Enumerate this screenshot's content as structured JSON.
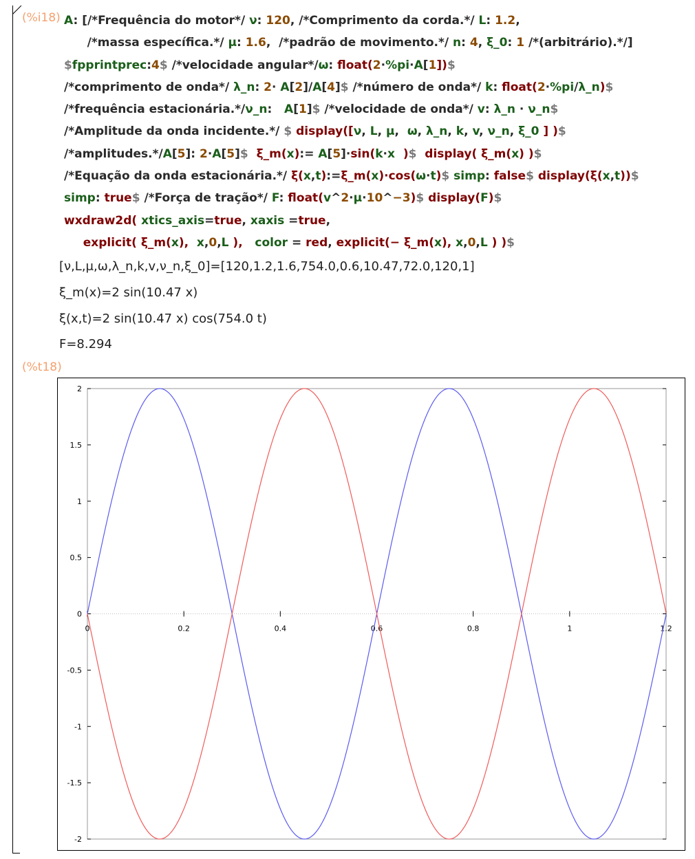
{
  "cells": {
    "input_label": "(%i18)",
    "plot_label": "(%t18)"
  },
  "code_lines": [
    [
      {
        "t": "A",
        "c": "v"
      },
      {
        "t": ": [/*Frequência do motor*/ ",
        "c": "c"
      },
      {
        "t": "ν",
        "c": "v"
      },
      {
        "t": ": ",
        "c": "c"
      },
      {
        "t": "120",
        "c": "n"
      },
      {
        "t": ", /*Comprimento da corda.*/ ",
        "c": "c"
      },
      {
        "t": "L",
        "c": "v"
      },
      {
        "t": ": ",
        "c": "c"
      },
      {
        "t": "1.2",
        "c": "n"
      },
      {
        "t": ",",
        "c": "c"
      }
    ],
    [
      {
        "t": "    /*massa específica.*/ ",
        "c": "c"
      },
      {
        "t": "μ",
        "c": "v"
      },
      {
        "t": ": ",
        "c": "c"
      },
      {
        "t": "1.6",
        "c": "n"
      },
      {
        "t": ",  /*padrão de movimento.*/ ",
        "c": "c"
      },
      {
        "t": "n",
        "c": "v"
      },
      {
        "t": ": ",
        "c": "c"
      },
      {
        "t": "4",
        "c": "n"
      },
      {
        "t": ", ",
        "c": "c"
      },
      {
        "t": "ξ_0",
        "c": "v"
      },
      {
        "t": ": ",
        "c": "c"
      },
      {
        "t": "1",
        "c": "n"
      },
      {
        "t": " /*(arbitrário).*/]",
        "c": "c"
      }
    ],
    [
      {
        "t": "$",
        "c": "o"
      },
      {
        "t": "fpprintprec",
        "c": "v"
      },
      {
        "t": ":",
        "c": "c"
      },
      {
        "t": "4",
        "c": "n"
      },
      {
        "t": "$",
        "c": "o"
      },
      {
        "t": " /*velocidade angular*/",
        "c": "c"
      },
      {
        "t": "ω",
        "c": "v"
      },
      {
        "t": ": ",
        "c": "c"
      },
      {
        "t": "float",
        "c": "k"
      },
      {
        "t": "(",
        "c": "k"
      },
      {
        "t": "2",
        "c": "n"
      },
      {
        "t": "·",
        "c": "c"
      },
      {
        "t": "%pi",
        "c": "v"
      },
      {
        "t": "·",
        "c": "c"
      },
      {
        "t": "A",
        "c": "v"
      },
      {
        "t": "[",
        "c": "c"
      },
      {
        "t": "1",
        "c": "n"
      },
      {
        "t": "])",
        "c": "k"
      },
      {
        "t": "$",
        "c": "o"
      }
    ],
    [
      {
        "t": "/*comprimento de onda*/ ",
        "c": "c"
      },
      {
        "t": "λ_n",
        "c": "v"
      },
      {
        "t": ": ",
        "c": "c"
      },
      {
        "t": "2",
        "c": "n"
      },
      {
        "t": "· ",
        "c": "c"
      },
      {
        "t": "A",
        "c": "v"
      },
      {
        "t": "[",
        "c": "c"
      },
      {
        "t": "2",
        "c": "n"
      },
      {
        "t": "]/",
        "c": "c"
      },
      {
        "t": "A",
        "c": "v"
      },
      {
        "t": "[",
        "c": "c"
      },
      {
        "t": "4",
        "c": "n"
      },
      {
        "t": "]",
        "c": "c"
      },
      {
        "t": "$",
        "c": "o"
      },
      {
        "t": " /*número de onda*/ ",
        "c": "c"
      },
      {
        "t": "k",
        "c": "v"
      },
      {
        "t": ": ",
        "c": "c"
      },
      {
        "t": "float",
        "c": "k"
      },
      {
        "t": "(",
        "c": "k"
      },
      {
        "t": "2",
        "c": "n"
      },
      {
        "t": "·",
        "c": "c"
      },
      {
        "t": "%pi",
        "c": "v"
      },
      {
        "t": "/",
        "c": "c"
      },
      {
        "t": "λ_n",
        "c": "v"
      },
      {
        "t": ")",
        "c": "k"
      },
      {
        "t": "$",
        "c": "o"
      }
    ],
    [
      {
        "t": "/*frequência estacionária.*/",
        "c": "c"
      },
      {
        "t": "ν_n",
        "c": "v"
      },
      {
        "t": ":   ",
        "c": "c"
      },
      {
        "t": "A",
        "c": "v"
      },
      {
        "t": "[",
        "c": "c"
      },
      {
        "t": "1",
        "c": "n"
      },
      {
        "t": "]",
        "c": "c"
      },
      {
        "t": "$",
        "c": "o"
      },
      {
        "t": " /*velocidade de onda*/ ",
        "c": "c"
      },
      {
        "t": "v",
        "c": "v"
      },
      {
        "t": ": ",
        "c": "c"
      },
      {
        "t": "λ_n",
        "c": "v"
      },
      {
        "t": " · ",
        "c": "c"
      },
      {
        "t": "ν_n",
        "c": "v"
      },
      {
        "t": "$",
        "c": "o"
      }
    ],
    [
      {
        "t": "/*Amplitude da onda incidente.*/ ",
        "c": "c"
      },
      {
        "t": "$",
        "c": "o"
      },
      {
        "t": " ",
        "c": "c"
      },
      {
        "t": "display",
        "c": "k"
      },
      {
        "t": "([",
        "c": "k"
      },
      {
        "t": "ν",
        "c": "v"
      },
      {
        "t": ", ",
        "c": "c"
      },
      {
        "t": "L",
        "c": "v"
      },
      {
        "t": ", ",
        "c": "c"
      },
      {
        "t": "μ",
        "c": "v"
      },
      {
        "t": ",  ",
        "c": "c"
      },
      {
        "t": "ω",
        "c": "v"
      },
      {
        "t": ", ",
        "c": "c"
      },
      {
        "t": "λ_n",
        "c": "v"
      },
      {
        "t": ", ",
        "c": "c"
      },
      {
        "t": "k",
        "c": "v"
      },
      {
        "t": ", ",
        "c": "c"
      },
      {
        "t": "v",
        "c": "v"
      },
      {
        "t": ", ",
        "c": "c"
      },
      {
        "t": "ν_n",
        "c": "v"
      },
      {
        "t": ", ",
        "c": "c"
      },
      {
        "t": "ξ_0",
        "c": "v"
      },
      {
        "t": " ] )",
        "c": "k"
      },
      {
        "t": "$",
        "c": "o"
      }
    ],
    [
      {
        "t": "/*amplitudes.*/",
        "c": "c"
      },
      {
        "t": "A",
        "c": "v"
      },
      {
        "t": "[",
        "c": "c"
      },
      {
        "t": "5",
        "c": "n"
      },
      {
        "t": "]: ",
        "c": "c"
      },
      {
        "t": "2",
        "c": "n"
      },
      {
        "t": "·",
        "c": "c"
      },
      {
        "t": "A",
        "c": "v"
      },
      {
        "t": "[",
        "c": "c"
      },
      {
        "t": "5",
        "c": "n"
      },
      {
        "t": "]",
        "c": "c"
      },
      {
        "t": "$",
        "c": "o"
      },
      {
        "t": "  ",
        "c": "c"
      },
      {
        "t": "ξ_m",
        "c": "k"
      },
      {
        "t": "(",
        "c": "k"
      },
      {
        "t": "x",
        "c": "v"
      },
      {
        "t": ")",
        "c": "k"
      },
      {
        "t": ":= ",
        "c": "c"
      },
      {
        "t": "A",
        "c": "v"
      },
      {
        "t": "[",
        "c": "c"
      },
      {
        "t": "5",
        "c": "n"
      },
      {
        "t": "]·",
        "c": "c"
      },
      {
        "t": "sin",
        "c": "k"
      },
      {
        "t": "(",
        "c": "k"
      },
      {
        "t": "k",
        "c": "v"
      },
      {
        "t": "·",
        "c": "c"
      },
      {
        "t": "x",
        "c": "v"
      },
      {
        "t": "  )",
        "c": "k"
      },
      {
        "t": "$",
        "c": "o"
      },
      {
        "t": "  ",
        "c": "c"
      },
      {
        "t": "display",
        "c": "k"
      },
      {
        "t": "( ",
        "c": "k"
      },
      {
        "t": "ξ_m",
        "c": "k"
      },
      {
        "t": "(",
        "c": "k"
      },
      {
        "t": "x",
        "c": "v"
      },
      {
        "t": ") )",
        "c": "k"
      },
      {
        "t": "$",
        "c": "o"
      }
    ],
    [
      {
        "t": "/*Equação da onda estacionária.*/ ",
        "c": "c"
      },
      {
        "t": "ξ",
        "c": "k"
      },
      {
        "t": "(",
        "c": "k"
      },
      {
        "t": "x",
        "c": "v"
      },
      {
        "t": ",",
        "c": "c"
      },
      {
        "t": "t",
        "c": "v"
      },
      {
        "t": ")",
        "c": "k"
      },
      {
        "t": ":=",
        "c": "c"
      },
      {
        "t": "ξ_m",
        "c": "k"
      },
      {
        "t": "(",
        "c": "k"
      },
      {
        "t": "x",
        "c": "v"
      },
      {
        "t": ")·",
        "c": "k"
      },
      {
        "t": "cos",
        "c": "k"
      },
      {
        "t": "(",
        "c": "k"
      },
      {
        "t": "ω",
        "c": "v"
      },
      {
        "t": "·",
        "c": "c"
      },
      {
        "t": "t",
        "c": "v"
      },
      {
        "t": ")",
        "c": "k"
      },
      {
        "t": "$",
        "c": "o"
      },
      {
        "t": " ",
        "c": "c"
      },
      {
        "t": "simp",
        "c": "v"
      },
      {
        "t": ": ",
        "c": "c"
      },
      {
        "t": "false",
        "c": "k"
      },
      {
        "t": "$",
        "c": "o"
      },
      {
        "t": " ",
        "c": "c"
      },
      {
        "t": "display",
        "c": "k"
      },
      {
        "t": "(",
        "c": "k"
      },
      {
        "t": "ξ",
        "c": "k"
      },
      {
        "t": "(",
        "c": "k"
      },
      {
        "t": "x",
        "c": "v"
      },
      {
        "t": ",",
        "c": "c"
      },
      {
        "t": "t",
        "c": "v"
      },
      {
        "t": "))",
        "c": "k"
      },
      {
        "t": "$",
        "c": "o"
      }
    ],
    [
      {
        "t": "simp",
        "c": "v"
      },
      {
        "t": ": ",
        "c": "c"
      },
      {
        "t": "true",
        "c": "k"
      },
      {
        "t": "$",
        "c": "o"
      },
      {
        "t": " /*Força de tração*/ ",
        "c": "c"
      },
      {
        "t": "F",
        "c": "v"
      },
      {
        "t": ": ",
        "c": "c"
      },
      {
        "t": "float",
        "c": "k"
      },
      {
        "t": "(",
        "c": "k"
      },
      {
        "t": "v",
        "c": "v"
      },
      {
        "t": "^",
        "c": "c"
      },
      {
        "t": "2",
        "c": "n"
      },
      {
        "t": "·",
        "c": "c"
      },
      {
        "t": "μ",
        "c": "v"
      },
      {
        "t": "·",
        "c": "c"
      },
      {
        "t": "10",
        "c": "n"
      },
      {
        "t": "^",
        "c": "c"
      },
      {
        "t": "−3",
        "c": "n"
      },
      {
        "t": ")",
        "c": "k"
      },
      {
        "t": "$",
        "c": "o"
      },
      {
        "t": " ",
        "c": "c"
      },
      {
        "t": "display",
        "c": "k"
      },
      {
        "t": "(",
        "c": "k"
      },
      {
        "t": "F",
        "c": "v"
      },
      {
        "t": ")",
        "c": "k"
      },
      {
        "t": "$",
        "c": "o"
      }
    ],
    [
      {
        "t": "wxdraw2d",
        "c": "k"
      },
      {
        "t": "( ",
        "c": "k"
      },
      {
        "t": "xtics_axis",
        "c": "v"
      },
      {
        "t": "=",
        "c": "c"
      },
      {
        "t": "true",
        "c": "k"
      },
      {
        "t": ", ",
        "c": "c"
      },
      {
        "t": "xaxis",
        "c": "v"
      },
      {
        "t": " =",
        "c": "c"
      },
      {
        "t": "true",
        "c": "k"
      },
      {
        "t": ",",
        "c": "c"
      }
    ],
    [
      {
        "t": "   ",
        "c": "c"
      },
      {
        "t": "explicit",
        "c": "k"
      },
      {
        "t": "( ",
        "c": "k"
      },
      {
        "t": "ξ_m",
        "c": "k"
      },
      {
        "t": "(",
        "c": "k"
      },
      {
        "t": "x",
        "c": "v"
      },
      {
        "t": "),  ",
        "c": "k"
      },
      {
        "t": "x",
        "c": "v"
      },
      {
        "t": ",",
        "c": "c"
      },
      {
        "t": "0",
        "c": "n"
      },
      {
        "t": ",",
        "c": "c"
      },
      {
        "t": "L",
        "c": "v"
      },
      {
        "t": " ),   ",
        "c": "k"
      },
      {
        "t": "color",
        "c": "v"
      },
      {
        "t": " = ",
        "c": "c"
      },
      {
        "t": "red",
        "c": "k"
      },
      {
        "t": ", ",
        "c": "c"
      },
      {
        "t": "explicit",
        "c": "k"
      },
      {
        "t": "(− ",
        "c": "k"
      },
      {
        "t": "ξ_m",
        "c": "k"
      },
      {
        "t": "(",
        "c": "k"
      },
      {
        "t": "x",
        "c": "v"
      },
      {
        "t": "), ",
        "c": "k"
      },
      {
        "t": "x",
        "c": "v"
      },
      {
        "t": ",",
        "c": "c"
      },
      {
        "t": "0",
        "c": "n"
      },
      {
        "t": ",",
        "c": "c"
      },
      {
        "t": "L",
        "c": "v"
      },
      {
        "t": " ) )",
        "c": "k"
      },
      {
        "t": "$",
        "c": "o"
      }
    ]
  ],
  "outputs": [
    "[ν,L,μ,ω,λ_n,k,v,ν_n,ξ_0]=[120,1.2,1.6,754.0,0.6,10.47,72.0,120,1]",
    "ξ_m(x)=2 sin(10.47 x)",
    "ξ(x,t)=2 sin(10.47 x) cos(754.0 t)",
    "F=8.294"
  ],
  "chart_data": {
    "type": "line",
    "xlim": [
      0,
      1.2
    ],
    "ylim": [
      -2,
      2
    ],
    "x_ticks": [
      "0",
      "0.2",
      "0.4",
      "0.6",
      "0.8",
      "1",
      "1.2"
    ],
    "y_ticks": [
      "2",
      "1.5",
      "1",
      "0.5",
      "0",
      "-0.5",
      "-1",
      "-1.5",
      "-2"
    ],
    "x_tick_values": [
      0,
      0.2,
      0.4,
      0.6,
      0.8,
      1.0,
      1.2
    ],
    "y_tick_values": [
      2,
      1.5,
      1,
      0.5,
      0,
      -0.5,
      -1,
      -1.5,
      -2
    ],
    "grid": false,
    "xaxis_drawn_at_zero": true,
    "series": [
      {
        "expr": "2 sin(10.47 x)",
        "color": "#5b5bf0",
        "amplitude": 2,
        "k": 10.47
      },
      {
        "expr": "-2 sin(10.47 x)",
        "color": "#f05b5b",
        "amplitude": -2,
        "k": 10.47
      }
    ]
  }
}
